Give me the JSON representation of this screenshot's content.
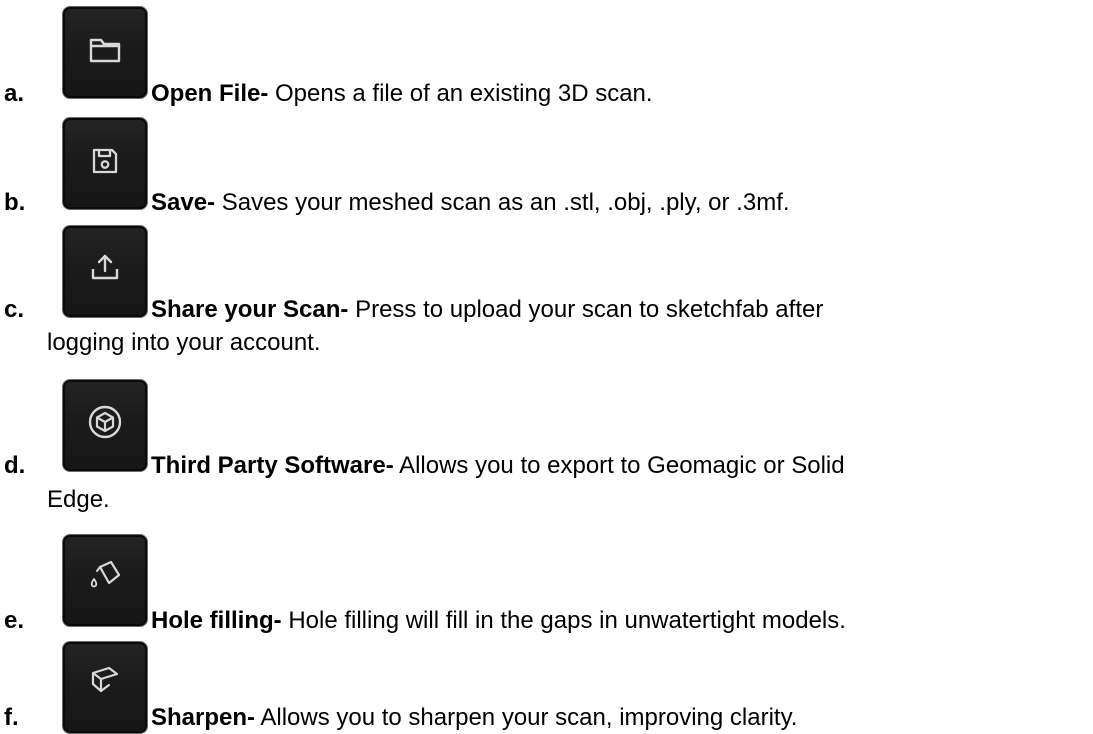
{
  "items": [
    {
      "marker": "a.",
      "term": "Open File-",
      "desc": " Opens a file of an existing 3D scan.",
      "desc2": "",
      "icon": "folder-icon"
    },
    {
      "marker": "b.",
      "term": "Save-",
      "desc": " Saves your meshed scan as an .stl, .obj, .ply, or .3mf.",
      "desc2": "",
      "icon": "save-icon"
    },
    {
      "marker": "c.",
      "term": "Share your Scan-",
      "desc": " Press to upload your scan to sketchfab after",
      "desc2": "logging into your account.",
      "icon": "upload-icon"
    },
    {
      "marker": "d.",
      "term": "Third Party Software-",
      "desc": " Allows you to export to Geomagic or Solid",
      "desc2": "Edge.",
      "icon": "cube-icon"
    },
    {
      "marker": "e.",
      "term": "Hole filling-",
      "desc": " Hole filling will fill in the gaps in unwatertight models.",
      "desc2": "",
      "icon": "paint-bucket-icon"
    },
    {
      "marker": "f.",
      "term": "Sharpen-",
      "desc": " Allows you to sharpen your scan, improving clarity.",
      "desc2": "",
      "icon": "sharpen-box-icon"
    }
  ],
  "colors": {
    "text": "#000000",
    "icon_bg": "#1b1b1b",
    "icon_stroke": "#d8d8d8"
  }
}
